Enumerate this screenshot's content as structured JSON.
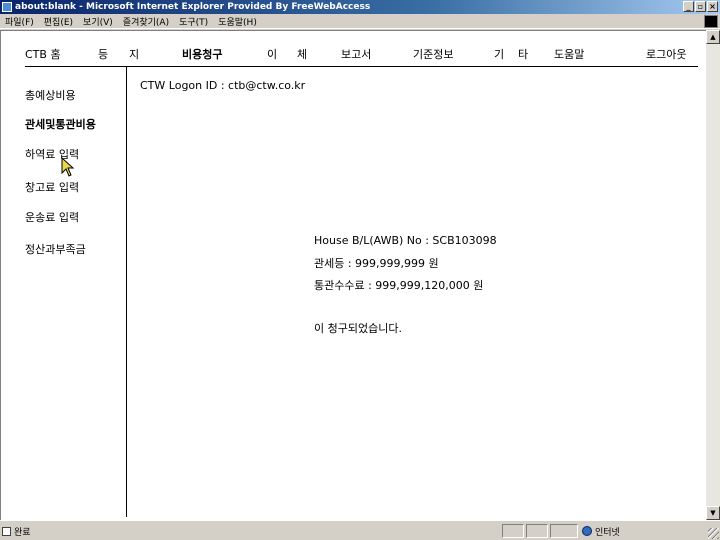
{
  "window": {
    "title": "about:blank - Microsoft Internet Explorer Provided By FreeWebAccess",
    "minimize_label": "_",
    "maximize_label": "▫",
    "close_label": "×"
  },
  "menubar": {
    "items": [
      {
        "label": "파일(F)"
      },
      {
        "label": "편집(E)"
      },
      {
        "label": "보기(V)"
      },
      {
        "label": "즐겨찾기(A)"
      },
      {
        "label": "도구(T)"
      },
      {
        "label": "도움말(H)"
      }
    ]
  },
  "topnav": {
    "items": [
      {
        "label": "CTB 홈"
      },
      {
        "label": "등"
      },
      {
        "label": "지"
      },
      {
        "label": "비용청구"
      },
      {
        "label": "이"
      },
      {
        "label": "체"
      },
      {
        "label": "보고서"
      },
      {
        "label": "기준정보"
      },
      {
        "label": "기"
      },
      {
        "label": "타"
      },
      {
        "label": "도움말"
      },
      {
        "label": "로그아웃"
      }
    ]
  },
  "sidenav": {
    "items": [
      {
        "label": "총예상비용"
      },
      {
        "label": "관세및통관비용"
      },
      {
        "label": "하역료 입력"
      },
      {
        "label": "창고료 입력"
      },
      {
        "label": "운송료 입력"
      },
      {
        "label": "정산과부족금"
      }
    ]
  },
  "main": {
    "logon_text": "CTW Logon ID : ctb@ctw.co.kr",
    "house_bl": "House B/L(AWB) No : SCB103098",
    "customs_duty": "관세등 : 999,999,999 원",
    "clearance_fee": "통관수수료 : 999,999,120,000  원",
    "message": "이 청구되었습니다."
  },
  "statusbar": {
    "status_text": "완료",
    "zone_text": "인터넷"
  }
}
